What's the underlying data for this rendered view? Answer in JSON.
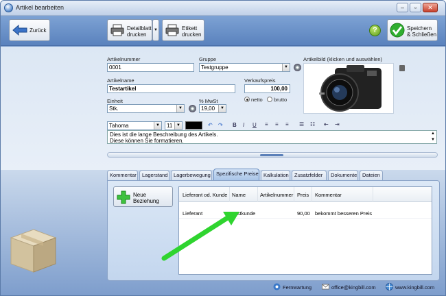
{
  "window": {
    "title": "Artikel bearbeiten"
  },
  "toolbar": {
    "back_label": "Zurück",
    "print_label": "Detailblatt\ndrucken",
    "label_label": "Etikett\ndrucken",
    "save_label": "Speichern\n& Schließen",
    "help_label": "?"
  },
  "form": {
    "article_number_label": "Artikelnummer",
    "article_number": "0001",
    "group_label": "Gruppe",
    "group_value": "Testgruppe",
    "article_name_label": "Artikelname",
    "article_name": "Testartikel",
    "price_label": "Verkaufspreis",
    "price": "100,00",
    "unit_label": "Einheit",
    "unit_value": "Stk.",
    "vat_label": "% MwSt",
    "vat_value": "19,00",
    "netto_label": "netto",
    "brutto_label": "brutto",
    "image_label": "Artikelbild (klicken und auswählen)"
  },
  "formatting": {
    "font": "Tahoma",
    "size": "11",
    "bold": "B",
    "italic": "I",
    "underline": "U"
  },
  "description": {
    "line1": "Dies ist die lange Beschreibung des Artikels.",
    "line2": "Diese können Sie formatieren."
  },
  "tabs": [
    "Kommentar",
    "Lagerstand",
    "Lagerbewegung",
    "Spezifische Preise",
    "Kalkulation",
    "Zusatzfelder",
    "Dokumente",
    "Dateien"
  ],
  "active_tab": "Spezifische Preise",
  "panel": {
    "new_relation_label": "Neue\nBeziehung",
    "columns": [
      "Lieferant od. Kunde",
      "Name",
      "Artikelnummer",
      "Preis",
      "Kommentar"
    ],
    "rows": [
      {
        "type": "Lieferant",
        "name": "Testkunde",
        "article_number": "",
        "price": "90,00",
        "comment": "bekommt besseren Preis"
      }
    ]
  },
  "footer": {
    "support": "Fernwartung",
    "email": "office@kingbill.com",
    "web": "www.kingbill.com"
  },
  "colors": {
    "accent": "#6f93c6",
    "arrow": "#33dd33",
    "save_check": "#22aa22"
  }
}
